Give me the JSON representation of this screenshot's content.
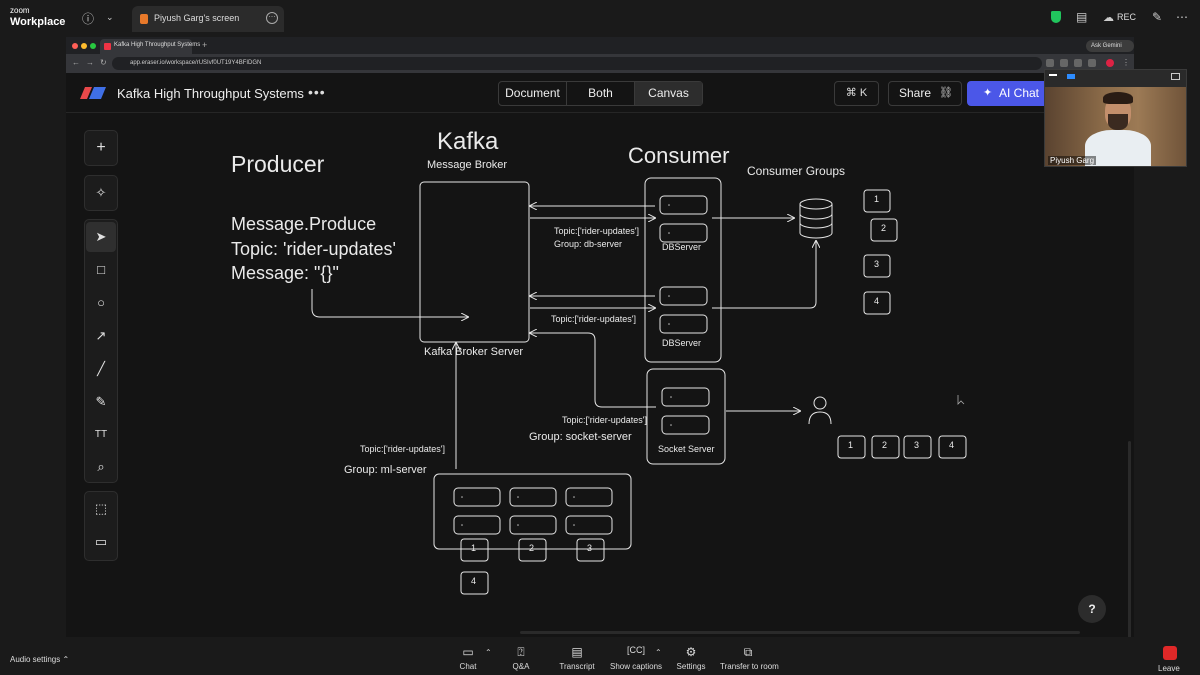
{
  "zoom": {
    "logo_top": "zoom",
    "logo_bottom": "Workplace",
    "share_tab_label": "Piyush Garg's screen",
    "rec_label": "REC",
    "participant_name": "Piyush Garg",
    "audio_settings": "Audio settings",
    "controls": [
      {
        "label": "Chat",
        "icon": "chat-icon"
      },
      {
        "label": "Q&A",
        "icon": "qa-icon"
      },
      {
        "label": "Transcript",
        "icon": "transcript-icon"
      },
      {
        "label": "Show captions",
        "icon": "captions-icon"
      },
      {
        "label": "Settings",
        "icon": "settings-icon"
      },
      {
        "label": "Transfer to room",
        "icon": "transfer-icon"
      }
    ],
    "leave_label": "Leave"
  },
  "browser": {
    "tab_title": "Kafka High Throughput Systems",
    "url": "app.eraser.io/workspace/rUSIvf0UT19Y4BFIDGN",
    "ask_gemini": "Ask Gemini"
  },
  "app": {
    "doc_title": "Kafka High Throughput Systems",
    "views": [
      "Document",
      "Both",
      "Canvas"
    ],
    "active_view": "Canvas",
    "cmdk": "⌘ K",
    "share": "Share",
    "ai_chat": "AI Chat",
    "help": "?"
  },
  "canvas": {
    "producer": {
      "title": "Producer",
      "line1": "Message.Produce",
      "line2": "Topic: 'rider-updates'",
      "line3": "Message: \"{}\""
    },
    "kafka": {
      "title": "Kafka",
      "subtitle": "Message Broker",
      "server_label": "Kafka Broker Server"
    },
    "consumer": {
      "title": "Consumer",
      "groups_title": "Consumer Groups",
      "db_topic": "Topic:['rider-updates']",
      "db_group": "Group: db-server",
      "db_server_1": "DBServer",
      "db_server_2": "DBServer",
      "topic_2": "Topic:['rider-updates']",
      "socket_topic": "Topic:['rider-updates']",
      "socket_group": "Group: socket-server",
      "socket_server": "Socket Server",
      "ml_topic": "Topic:['rider-updates']",
      "ml_group": "Group: ml-server"
    },
    "partitions_right": [
      "1",
      "2",
      "3",
      "4"
    ],
    "partitions_user": [
      "1",
      "2",
      "3",
      "4"
    ],
    "partitions_ml": [
      "1",
      "2",
      "3",
      "4"
    ]
  }
}
